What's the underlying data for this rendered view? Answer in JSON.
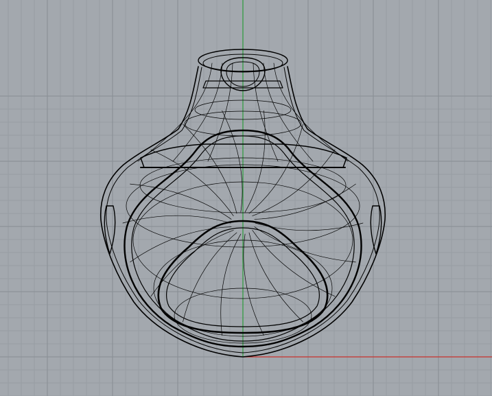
{
  "viewport": {
    "view": "perspective-wireframe",
    "background_color": "#a3a8ae",
    "grid_minor_color": "#979da3",
    "grid_major_color": "#878d93",
    "x_axis_color": "#c8302c",
    "y_axis_color": "#2a9b3a",
    "wire_color": "#000000"
  },
  "model": {
    "shape": "bulbous-bottle-wireframe"
  }
}
